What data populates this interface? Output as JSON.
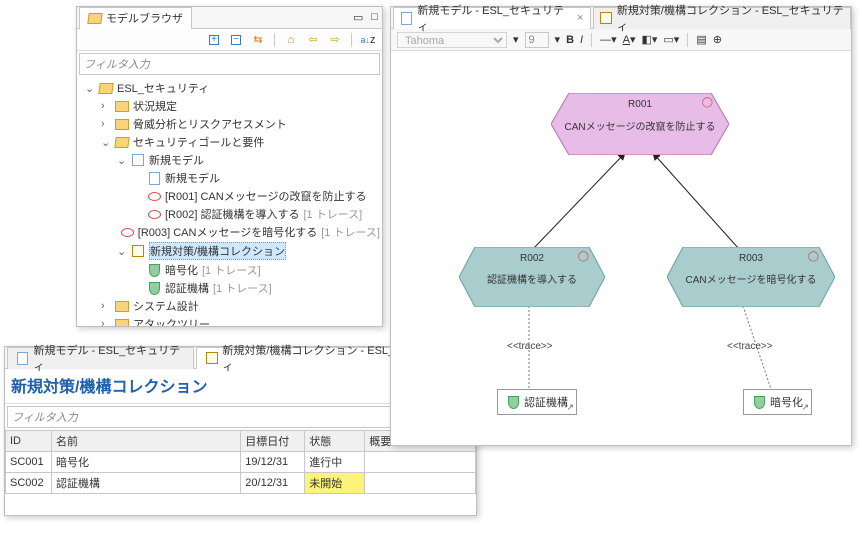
{
  "browser": {
    "title": "モデルブラウザ",
    "filter_placeholder": "フィルタ入力",
    "toolbar": {
      "expand": "+",
      "collapse": "-",
      "sync": "↻",
      "home": "⌂",
      "back": "⇦",
      "fwd": "⇨",
      "sort": "a↓z"
    },
    "tree": [
      {
        "lvl": 0,
        "twisty": "v",
        "icon": "folder-open",
        "text": "ESL_セキュリティ"
      },
      {
        "lvl": 1,
        "twisty": ">",
        "icon": "folder",
        "text": "状況規定"
      },
      {
        "lvl": 1,
        "twisty": ">",
        "icon": "folder",
        "text": "脅威分析とリスクアセスメント"
      },
      {
        "lvl": 1,
        "twisty": "v",
        "icon": "folder-open",
        "text": "セキュリティゴールと要件"
      },
      {
        "lvl": 2,
        "twisty": "v",
        "icon": "mdl",
        "text": "新規モデル"
      },
      {
        "lvl": 3,
        "twisty": "",
        "icon": "mdl-doc",
        "text": "新規モデル"
      },
      {
        "lvl": 3,
        "twisty": "",
        "icon": "oval",
        "text": "[R001] CANメッセージの改竄を防止する"
      },
      {
        "lvl": 3,
        "twisty": "",
        "icon": "oval",
        "text": "[R002] 認証機構を導入する",
        "trace": "[1 トレース]"
      },
      {
        "lvl": 3,
        "twisty": "",
        "icon": "oval",
        "text": "[R003] CANメッセージを暗号化する",
        "trace": "[1 トレース]"
      },
      {
        "lvl": 2,
        "twisty": "v",
        "icon": "box",
        "text": "新規対策/機構コレクション",
        "selected": true
      },
      {
        "lvl": 3,
        "twisty": "",
        "icon": "shield",
        "text": "暗号化",
        "trace": "[1 トレース]"
      },
      {
        "lvl": 3,
        "twisty": "",
        "icon": "shield",
        "text": "認証機構",
        "trace": "[1 トレース]"
      },
      {
        "lvl": 1,
        "twisty": ">",
        "icon": "folder",
        "text": "システム設計"
      },
      {
        "lvl": 1,
        "twisty": ">",
        "icon": "folder",
        "text": "アタックツリー"
      }
    ]
  },
  "detail": {
    "tabs": [
      {
        "label": "新規モデル - ESL_セキュリティ",
        "icon": "mdl-doc"
      },
      {
        "label": "新規対策/機構コレクション - ESL_セキュリティ",
        "icon": "box",
        "active": true
      }
    ],
    "title": "新規対策/機構コレクション",
    "filter_placeholder": "フィルタ入力",
    "columns": [
      "ID",
      "名前",
      "目標日付",
      "状態",
      "概要"
    ],
    "rows": [
      {
        "id": "SC001",
        "name": "暗号化",
        "date": "19/12/31",
        "status": "進行中",
        "summary": "",
        "warn": false
      },
      {
        "id": "SC002",
        "name": "認証機構",
        "date": "20/12/31",
        "status": "未開始",
        "summary": "",
        "warn": true
      }
    ]
  },
  "diagram": {
    "tabs": [
      {
        "label": "新規モデル - ESL_セキュリティ",
        "icon": "mdl-doc",
        "active": true
      },
      {
        "label": "新規対策/機構コレクション - ESL_セキュリティ",
        "icon": "box"
      }
    ],
    "format": {
      "font": "Tahoma",
      "size": "9",
      "bold": "B",
      "italic": "I"
    },
    "nodes": {
      "r001": {
        "id": "R001",
        "text": "CANメッセージの改竄を防止する",
        "fill": "#e7bde7",
        "stroke": "#b070b0"
      },
      "r002": {
        "id": "R002",
        "text": "認証機構を導入する",
        "fill": "#a9cccc",
        "stroke": "#6aa0a0"
      },
      "r003": {
        "id": "R003",
        "text": "CANメッセージを暗号化する",
        "fill": "#a9cccc",
        "stroke": "#6aa0a0"
      }
    },
    "trace_label": "<<trace>>",
    "mech1": "認証機構",
    "mech2": "暗号化"
  }
}
